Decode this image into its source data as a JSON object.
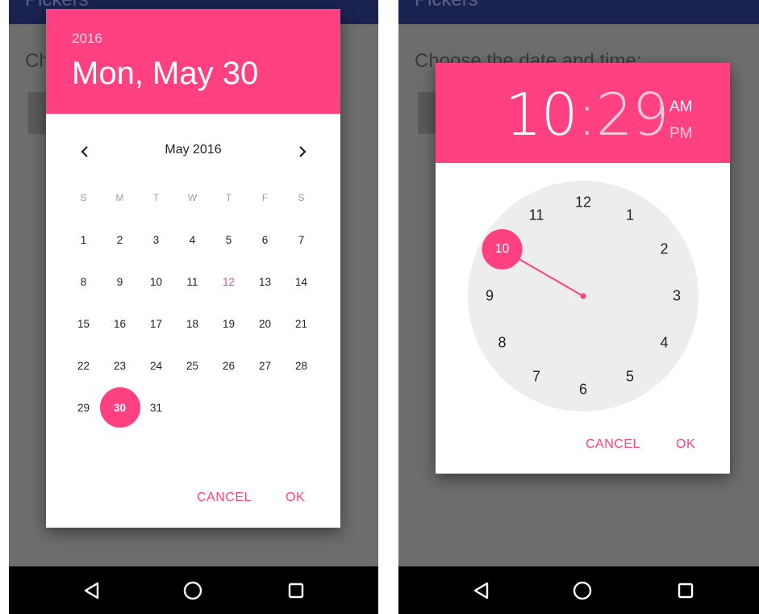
{
  "left_screen": {
    "app_title": "Pickers",
    "background_text": "Ch",
    "date_picker": {
      "year": "2016",
      "title": "Mon, May 30",
      "month_label": "May 2016",
      "weekdays": [
        "S",
        "M",
        "T",
        "W",
        "T",
        "F",
        "S"
      ],
      "days": [
        [
          "1",
          "2",
          "3",
          "4",
          "5",
          "6",
          "7"
        ],
        [
          "8",
          "9",
          "10",
          "11",
          "12",
          "13",
          "14"
        ],
        [
          "15",
          "16",
          "17",
          "18",
          "19",
          "20",
          "21"
        ],
        [
          "22",
          "23",
          "24",
          "25",
          "26",
          "27",
          "28"
        ],
        [
          "29",
          "30",
          "31"
        ]
      ],
      "selected_day": "30",
      "highlighted_day": "12",
      "cancel_label": "CANCEL",
      "ok_label": "OK"
    }
  },
  "right_screen": {
    "app_title": "Pickers",
    "background_text": "Choose the date and time:",
    "time_picker": {
      "hour": "10",
      "separator": ":",
      "minute": "29",
      "am_label": "AM",
      "pm_label": "PM",
      "selected_period": "AM",
      "clock_numbers": [
        "12",
        "1",
        "2",
        "3",
        "4",
        "5",
        "6",
        "7",
        "8",
        "9",
        "10",
        "11"
      ],
      "selected_hour": "10",
      "cancel_label": "CANCEL",
      "ok_label": "OK"
    }
  },
  "navigation": {
    "back_icon": "back-triangle-icon",
    "home_icon": "home-circle-icon",
    "recents_icon": "recents-square-icon"
  },
  "colors": {
    "accent": "#ff4081",
    "app_bar": "#1a2350",
    "scrim": "#6d6d6d",
    "clock_face": "#ededed"
  }
}
